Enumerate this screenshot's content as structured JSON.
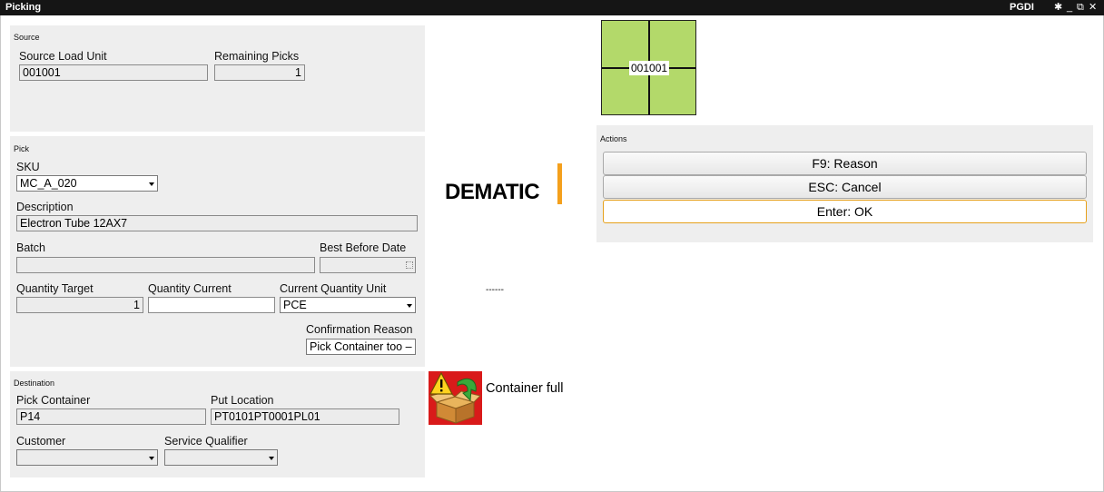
{
  "titlebar": {
    "title": "Picking",
    "app": "PGDI",
    "pin_glyph": "✱",
    "minimize_glyph": "_",
    "restore_glyph": "⧉",
    "close_glyph": "✕"
  },
  "source": {
    "panel_title": "Source",
    "source_load_unit_label": "Source Load Unit",
    "source_load_unit_value": "001001",
    "remaining_picks_label": "Remaining Picks",
    "remaining_picks_value": "1"
  },
  "pick": {
    "panel_title": "Pick",
    "sku_label": "SKU",
    "sku_value": "MC_A_020",
    "description_label": "Description",
    "description_value": "Electron Tube 12AX7",
    "batch_label": "Batch",
    "batch_value": "",
    "best_before_label": "Best Before Date",
    "best_before_value": "",
    "quantity_target_label": "Quantity Target",
    "quantity_target_value": "1",
    "quantity_current_label": "Quantity Current",
    "quantity_current_value": "",
    "current_quantity_unit_label": "Current Quantity Unit",
    "current_quantity_unit_value": "PCE",
    "confirmation_reason_label": "Confirmation Reason",
    "confirmation_reason_value": "Pick Container too –"
  },
  "destination": {
    "panel_title": "Destination",
    "pick_container_label": "Pick Container",
    "pick_container_value": "P14",
    "put_location_label": "Put Location",
    "put_location_value": "PT0101PT0001PL01",
    "customer_label": "Customer",
    "customer_value": "",
    "service_qualifier_label": "Service Qualifier",
    "service_qualifier_value": ""
  },
  "load_unit_grid": {
    "label": "001001",
    "color": "#b3d96a"
  },
  "brand": {
    "logo_text": "DEMATIC",
    "accent_color": "#f4a01c"
  },
  "status": {
    "dash_text": "------",
    "container_full_text": "Container full",
    "icon": "container-full-warning-icon"
  },
  "actions": {
    "panel_title": "Actions",
    "reason_button": "F9: Reason",
    "cancel_button": "ESC: Cancel",
    "ok_button": "Enter: OK"
  }
}
